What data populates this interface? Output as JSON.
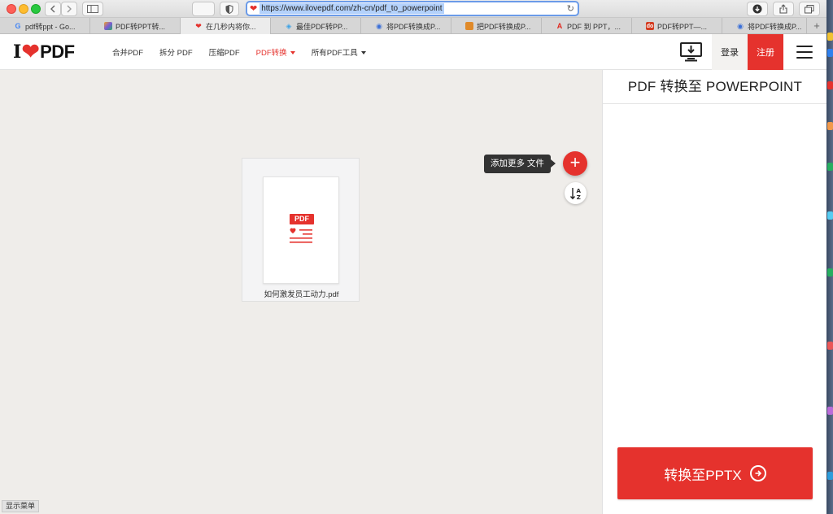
{
  "browser": {
    "url": "https://www.ilovepdf.com/zh-cn/pdf_to_powerpoint",
    "tabs": [
      {
        "label": "pdf转ppt - Go...",
        "icon": "google-icon",
        "color": "#4285f4",
        "glyph": "G"
      },
      {
        "label": "PDF转PPT转...",
        "icon": "multicolor-grid-icon",
        "color": "#7a5ad8",
        "glyph": "▦"
      },
      {
        "label": "在几秒内将你...",
        "icon": "ilovepdf-heart-icon",
        "color": "#e5322d",
        "glyph": "♥"
      },
      {
        "label": "最佳PDF转PP...",
        "icon": "blue-swirl-icon",
        "color": "#3ea3e6",
        "glyph": "◈"
      },
      {
        "label": "将PDF转换成P...",
        "icon": "blue-circle-icon",
        "color": "#3a6fd8",
        "glyph": "◉"
      },
      {
        "label": "把PDF转换成P...",
        "icon": "orange-doc-icon",
        "color": "#e08a2a",
        "glyph": "▮"
      },
      {
        "label": "PDF 到 PPT，...",
        "icon": "adobe-icon",
        "color": "#e0281e",
        "glyph": "A"
      },
      {
        "label": "PDF转PPT—...",
        "icon": "red-do-icon",
        "color": "#d33c21",
        "glyph": "do"
      },
      {
        "label": "将PDF转换成P...",
        "icon": "blue-circle-icon",
        "color": "#3a6fd8",
        "glyph": "◉"
      }
    ],
    "new_tab": "+"
  },
  "header": {
    "logo_left": "I",
    "logo_right": "PDF",
    "nav": {
      "merge": "合并PDF",
      "split": "拆分 PDF",
      "compress": "压缩PDF",
      "convert": "PDF转换",
      "all_tools": "所有PDF工具"
    },
    "login": "登录",
    "signup": "注册"
  },
  "workspace": {
    "file_name": "如何激发员工动力.pdf",
    "file_badge": "PDF",
    "add_tooltip": "添加更多 文件",
    "add_symbol": "+"
  },
  "sidebar": {
    "title": "PDF 转换至 POWERPOINT",
    "convert_button": "转换至PPTX"
  },
  "status_bar": "显示菜单",
  "colors": {
    "brand_red": "#e5322d",
    "background": "#efedea"
  }
}
